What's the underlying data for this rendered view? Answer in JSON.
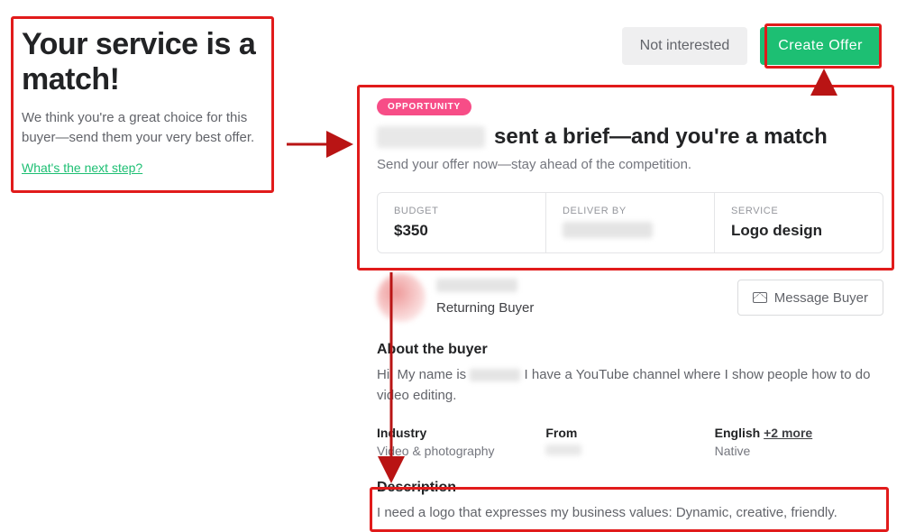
{
  "left": {
    "title": "Your service is a match!",
    "subtext": "We think you're a great choice for this buyer—send them your very best offer.",
    "step_link": "What's the next step?"
  },
  "actions": {
    "not_interested": "Not interested",
    "create_offer": "Create  Offer",
    "message_buyer": "Message Buyer"
  },
  "brief": {
    "badge": "OPPORTUNITY",
    "headline_suffix": "sent a brief—and you're a match",
    "sub": "Send your offer now—stay ahead of the competition.",
    "stats": {
      "budget_label": "BUDGET",
      "budget_value": "$350",
      "deliver_label": "DELIVER BY",
      "service_label": "SERVICE",
      "service_value": "Logo design"
    }
  },
  "buyer": {
    "returning": "Returning Buyer",
    "about_title": "About the buyer",
    "about_prefix": "Hi, My name is",
    "about_suffix": "I have a YouTube channel where I show people how to do video editing.",
    "industry_label": "Industry",
    "industry_value": "Video & photography",
    "from_label": "From",
    "lang_label": "English",
    "lang_more": "+2 more",
    "lang_value": "Native"
  },
  "description": {
    "title": "Description",
    "text": "I need a logo that expresses my business values: Dynamic, creative, friendly."
  }
}
